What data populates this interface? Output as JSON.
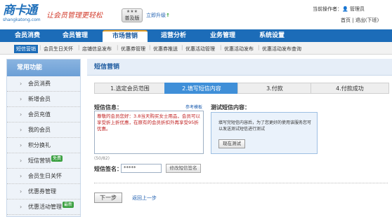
{
  "header": {
    "logo_main": "商卡通",
    "logo_sub": "shangkatong.com",
    "slogan": "让会员管理更轻松",
    "edition_stars": "★★★",
    "edition_label": "普及版",
    "upgrade_label": "立即升级",
    "operator_label": "当前操作者：",
    "operator_name": "管理员",
    "home_link": "首页",
    "logout_link": "退出(下班)"
  },
  "main_nav": [
    {
      "label": "会员消费"
    },
    {
      "label": "会员管理"
    },
    {
      "label": "市场营销"
    },
    {
      "label": "运营分析"
    },
    {
      "label": "业务管理"
    },
    {
      "label": "系统设置"
    }
  ],
  "sub_nav": [
    {
      "label": "短信营销"
    },
    {
      "label": "会员生日关怀"
    },
    {
      "label": "店铺信息发布"
    },
    {
      "label": "优惠券管理"
    },
    {
      "label": "优惠券推送"
    },
    {
      "label": "优惠活动管理"
    },
    {
      "label": "优惠活动发布"
    },
    {
      "label": "优惠活动发布查询"
    }
  ],
  "sidebar": {
    "title": "常用功能",
    "items": [
      {
        "label": "会员消费",
        "badge": ""
      },
      {
        "label": "新增会员",
        "badge": ""
      },
      {
        "label": "会员充值",
        "badge": ""
      },
      {
        "label": "我的会员",
        "badge": ""
      },
      {
        "label": "积分换礼",
        "badge": ""
      },
      {
        "label": "短信营销",
        "badge": "免费"
      },
      {
        "label": "会员生日关怀",
        "badge": ""
      },
      {
        "label": "优惠券管理",
        "badge": ""
      },
      {
        "label": "优惠活动管理",
        "badge": "最新"
      }
    ]
  },
  "content": {
    "title": "短信营销",
    "steps": [
      {
        "label": "1.选定会员范围"
      },
      {
        "label": "2.填写短信内容"
      },
      {
        "label": "3.付款"
      },
      {
        "label": "4.付款成功"
      }
    ],
    "sms_label": "短信信息：",
    "template_link": "参考模板",
    "sms_text": "尊敬的会员您好：3.8当天购买女士用品，会员可以享受折上折优惠，在原有的会员折扣外再享受95折优惠。",
    "counter": "(50/82)",
    "sign_label": "短信签名：",
    "sign_value": "*****",
    "sign_button": "修改短信签名",
    "test_label": "测试短信内容：",
    "test_desc": "填写完短信内容后，为了您更好的使用该服务您可以发送测试短信进行测试",
    "test_button": "现在测试",
    "next_button": "下一步",
    "back_link": "返回上一步"
  },
  "colors": {
    "nav_blue": "#1c6cb8",
    "active_step": "#3f8fd8",
    "link_blue": "#1f5fb0",
    "sms_text_red": "#c02020",
    "badge_green": "#3aa040"
  }
}
